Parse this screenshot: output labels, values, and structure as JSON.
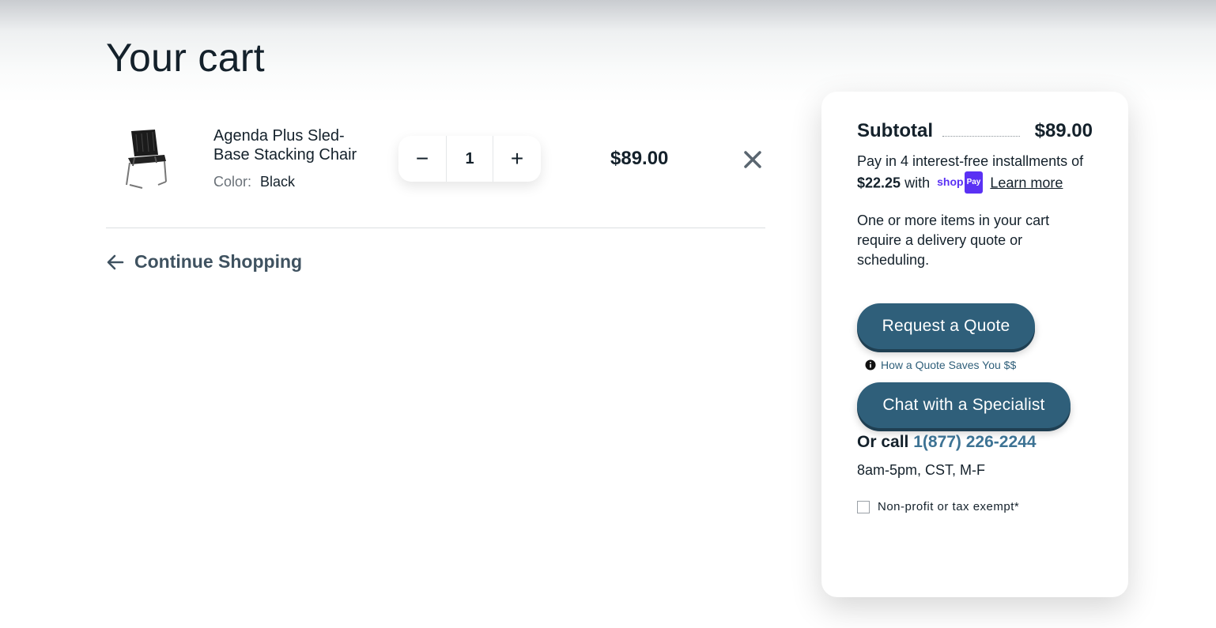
{
  "page": {
    "title": "Your cart"
  },
  "cart": {
    "items": [
      {
        "name": "Agenda Plus Sled-Base Stacking Chair",
        "variant_label": "Color:",
        "variant_value": "Black",
        "quantity": "1",
        "price": "$89.00"
      }
    ],
    "decrement_symbol": "−",
    "increment_symbol": "+",
    "continue_label": "Continue Shopping"
  },
  "summary": {
    "subtotal_label": "Subtotal",
    "subtotal_value": "$89.00",
    "installments_prefix": "Pay in 4 interest-free installments of",
    "installment_amount": "$22.25",
    "installments_with": "with",
    "shoppay_brand": "shop",
    "shoppay_pay": "Pay",
    "learn_more": "Learn more",
    "delivery_note": "One or more items in your cart require a delivery quote or scheduling.",
    "quote_button": "Request a Quote",
    "quote_info": "How a Quote Saves You $$",
    "chat_button": "Chat with a Specialist",
    "call_prefix": "Or call",
    "phone": "1(877) 226-2244",
    "hours": "8am-5pm, CST, M-F",
    "tax_exempt": "Non-profit or tax exempt*"
  },
  "colors": {
    "accent": "#2f5f7a",
    "link": "#3d7394",
    "text": "#14212b",
    "shoppay": "#5a31f4"
  },
  "icons": [
    "chair-thumbnail",
    "close-icon",
    "arrow-left-icon",
    "info-icon",
    "shoppay-logo"
  ]
}
